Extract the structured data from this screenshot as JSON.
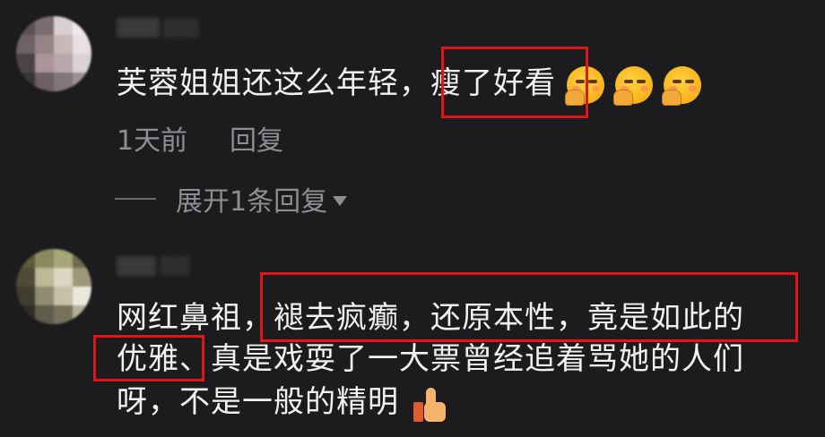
{
  "comments": [
    {
      "text_before": "芙蓉姐姐还这么年轻，",
      "text_highlight": "瘦了好看",
      "emoji_name": "shy-blush-emoji",
      "time": "1天前",
      "reply_label": "回复",
      "expand_label": "展开1条回复"
    },
    {
      "line1_a": "网红鼻祖，",
      "line1_highlight": "褪去疯癫，还原本性，竟是如此的",
      "line2_highlight": "优雅",
      "line2_rest": "、真是戏耍了一大票曾经追着骂她的人们",
      "line3": "呀，不是一般的精明",
      "emoji_name": "thumbs-up-emoji"
    }
  ],
  "colors": {
    "background": "#1c1c1e",
    "text": "#f2f2f2",
    "meta_text": "#8e8e93",
    "highlight_border": "#e3151b"
  }
}
